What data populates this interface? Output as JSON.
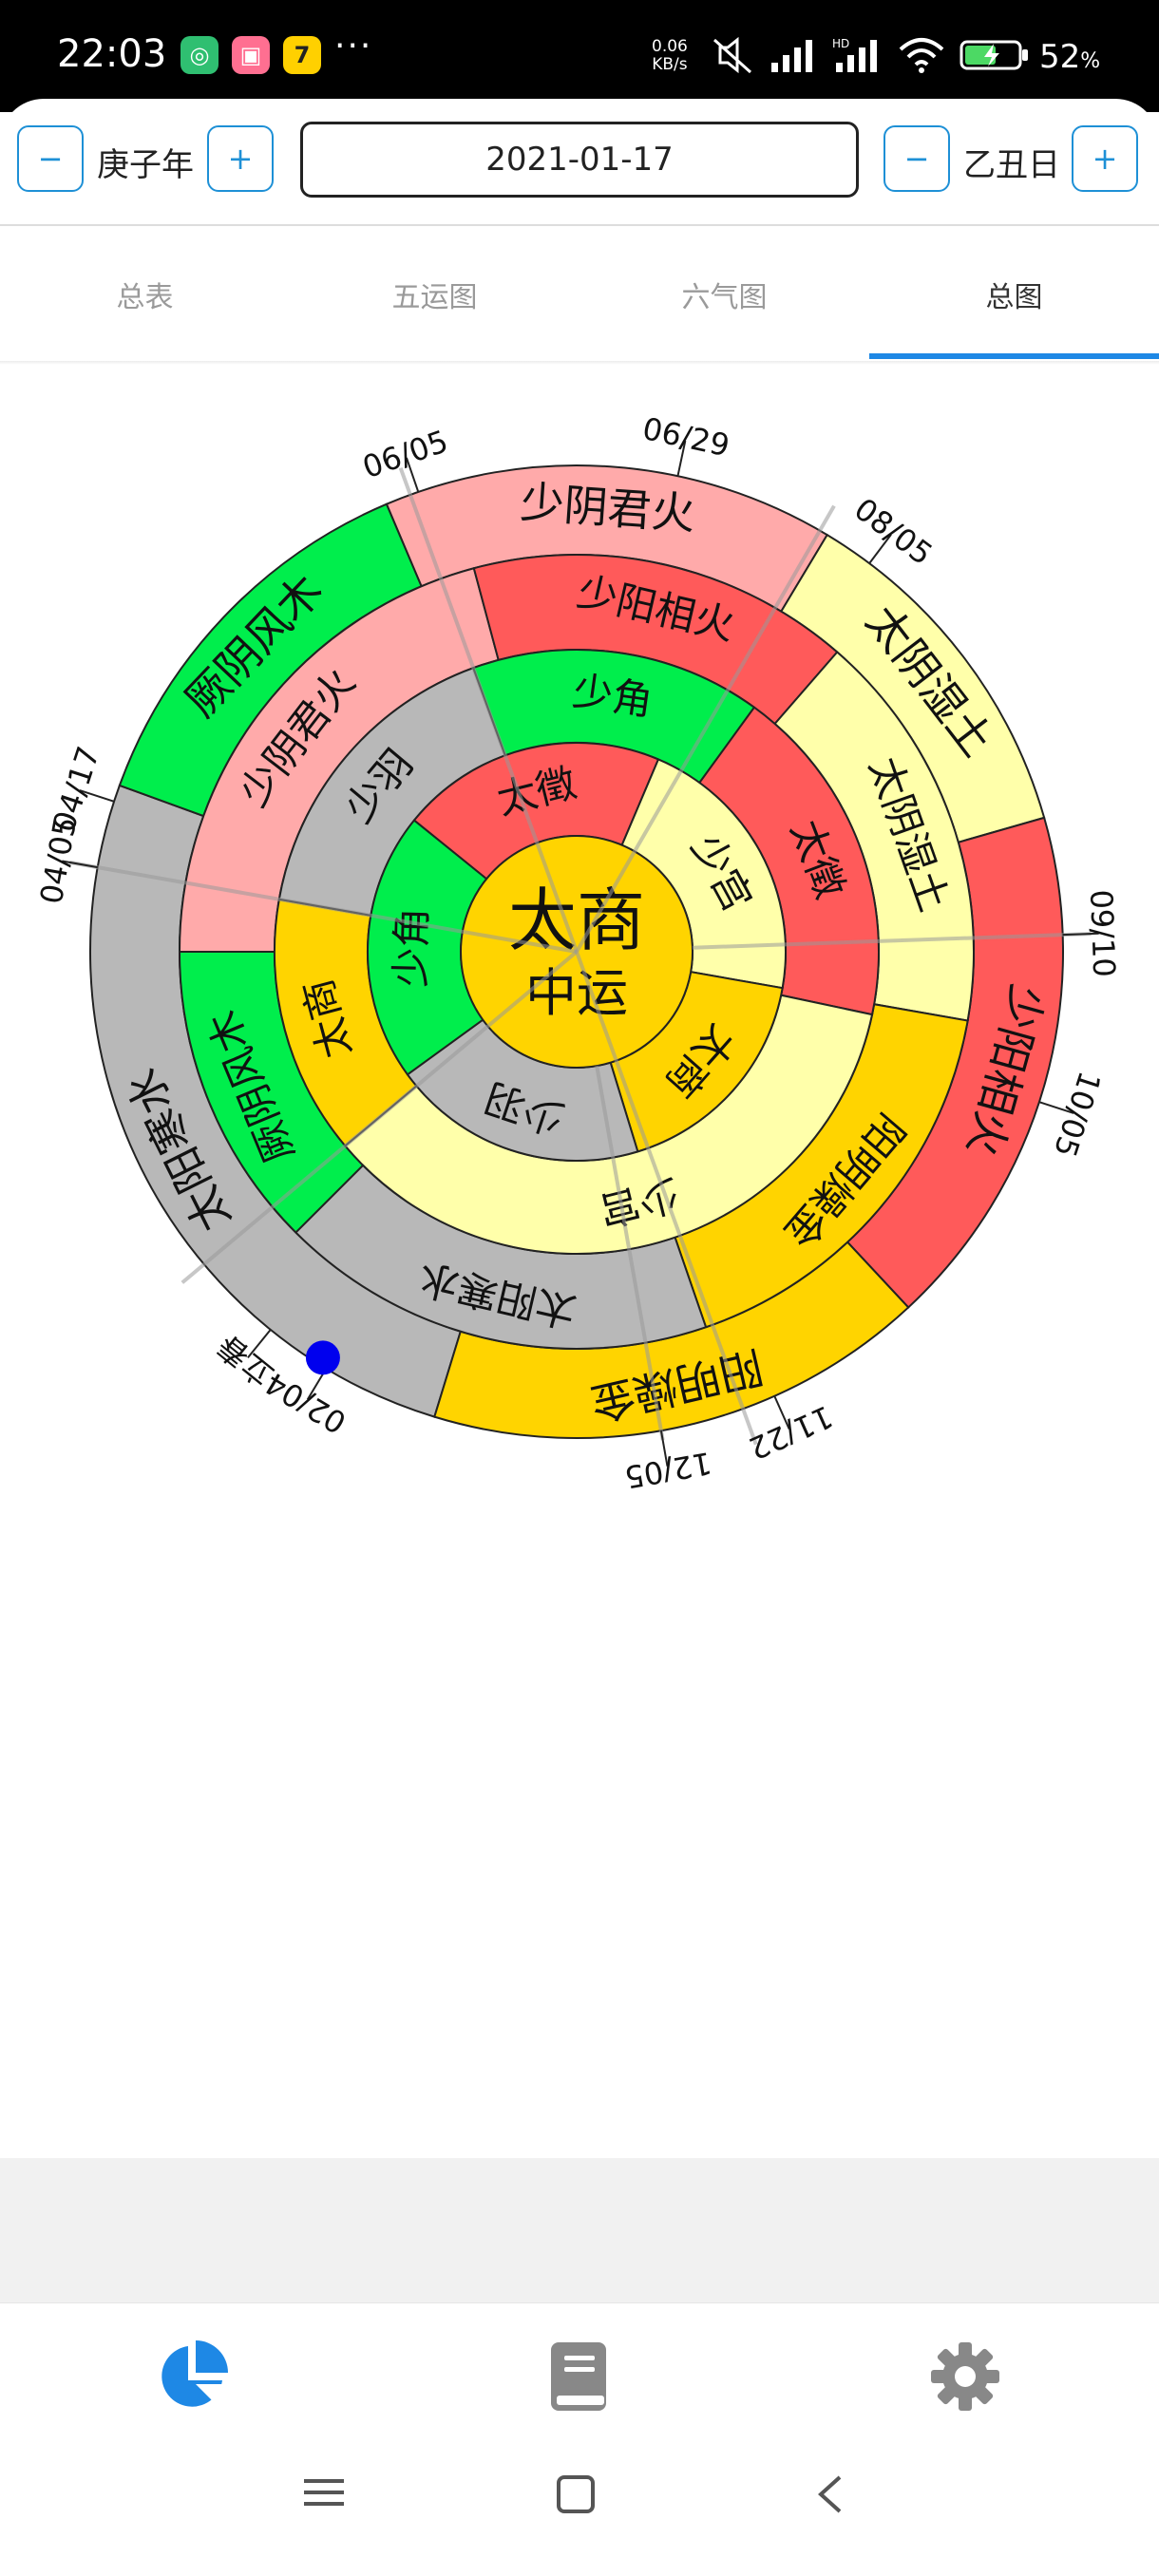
{
  "status_bar": {
    "time": "22:03",
    "network_speed": "0.06",
    "network_unit": "KB/s",
    "battery_percent": "52",
    "battery_unit": "%",
    "more": "···"
  },
  "top_bar": {
    "year": {
      "label": "庚子年",
      "minus": "−",
      "plus": "+"
    },
    "date": "2021-01-17",
    "day": {
      "label": "乙丑日",
      "minus": "−",
      "plus": "+"
    }
  },
  "tabs": [
    {
      "label": "总表",
      "active": false
    },
    {
      "label": "五运图",
      "active": false
    },
    {
      "label": "六气图",
      "active": false
    },
    {
      "label": "总图",
      "active": true
    }
  ],
  "wheel": {
    "center": {
      "line1": "太商",
      "line2": "中运"
    },
    "inner_ring": [
      {
        "label": "少角",
        "color": "#00ee4c"
      },
      {
        "label": "太徵",
        "color": "#ff5a5a"
      },
      {
        "label": "少宫",
        "color": "#ffffaa"
      },
      {
        "label": "太商",
        "color": "#ffd400"
      },
      {
        "label": "少羽",
        "color": "#b8b8b8"
      }
    ],
    "second_ring": [
      {
        "label": "太商",
        "color": "#ffd400"
      },
      {
        "label": "少羽",
        "color": "#b8b8b8"
      },
      {
        "label": "少角",
        "color": "#00ee4c"
      },
      {
        "label": "太徵",
        "color": "#ff5a5a"
      },
      {
        "label": "少宫",
        "color": "#ffffaa"
      }
    ],
    "third_ring": [
      {
        "label": "厥阴风木",
        "color": "#00ee4c"
      },
      {
        "label": "少阴君火",
        "color": "#ffaaaa"
      },
      {
        "label": "少阳相火",
        "color": "#ff5a5a"
      },
      {
        "label": "太阴湿土",
        "color": "#ffffaa"
      },
      {
        "label": "阳明燥金",
        "color": "#ffd400"
      },
      {
        "label": "太阳寒水",
        "color": "#b8b8b8"
      }
    ],
    "outer_ring": [
      {
        "label": "太阳寒水",
        "color": "#b8b8b8"
      },
      {
        "label": "厥阴风木",
        "color": "#00ee4c"
      },
      {
        "label": "少阴君火",
        "color": "#ffaaaa"
      },
      {
        "label": "太阴湿土",
        "color": "#ffffaa"
      },
      {
        "label": "少阳相火",
        "color": "#ff5a5a"
      },
      {
        "label": "阳明燥金",
        "color": "#ffd400"
      }
    ],
    "dates": [
      "立春",
      "02/04",
      "04/05",
      "04/17",
      "06/05",
      "06/29",
      "08/05",
      "09/10",
      "10/05",
      "11/22",
      "12/05"
    ],
    "marker_color": "#0000ee",
    "current_date": "2021-01-17"
  },
  "bottom_nav": [
    {
      "icon": "pie-chart-icon",
      "active": true,
      "color": "#1e88e5"
    },
    {
      "icon": "book-icon",
      "active": false,
      "color": "#888888"
    },
    {
      "icon": "gear-icon",
      "active": false,
      "color": "#888888"
    }
  ]
}
